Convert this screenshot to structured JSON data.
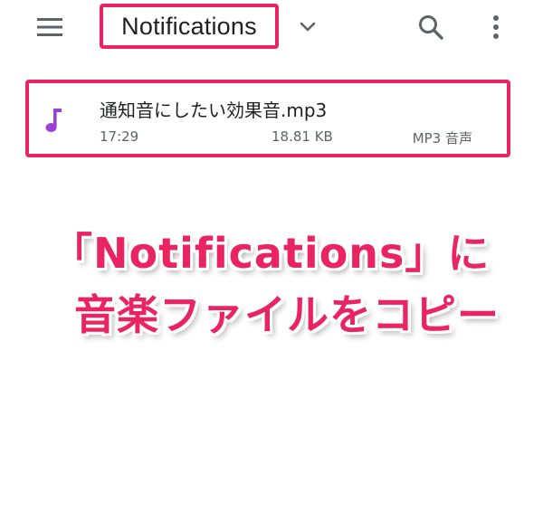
{
  "app_bar": {
    "title": "Notifications",
    "icons": {
      "menu": "hamburger-menu-icon",
      "dropdown": "chevron-down-icon",
      "search": "search-icon",
      "more": "more-vert-icon"
    }
  },
  "file": {
    "name": "通知音にしたい効果音.mp3",
    "time": "17:29",
    "size": "18.81 KB",
    "type": "MP3 音声",
    "icon": "music-note-icon"
  },
  "annotation": {
    "line1": "「Notifications」に",
    "line2": "音楽ファイルをコピー"
  },
  "colors": {
    "highlight": "#ea2462",
    "icon_gray": "#5f6368",
    "music_icon": "#9b3fd6",
    "text": "#202124"
  }
}
